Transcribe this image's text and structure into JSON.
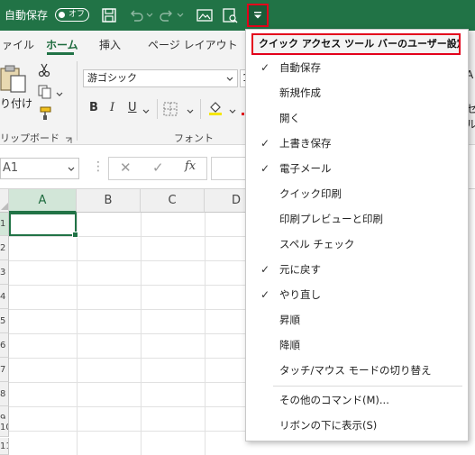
{
  "titlebar": {
    "autosave_label": "自動保存",
    "autosave_state": "オフ",
    "qa_icons": [
      "save-icon",
      "undo-icon",
      "redo-icon",
      "new-file-icon",
      "print-preview-icon",
      "customize-dropdown-icon"
    ]
  },
  "ribbon": {
    "tabs": [
      "ァイル",
      "ホーム",
      "挿入",
      "ページ レイアウト"
    ],
    "active_tab": "ホーム",
    "clipboard": {
      "paste_label": "り付け",
      "group_label": "リップボード"
    },
    "font": {
      "name": "游ゴシック",
      "size": "1",
      "group_label": "フォント",
      "bold": "B",
      "italic": "I",
      "underline": "U"
    },
    "right_fragment_1": "A",
    "right_fragment_2": "セル"
  },
  "formula_bar": {
    "name_box": "A1",
    "fx": "fx"
  },
  "grid": {
    "columns": [
      "A",
      "B",
      "C",
      "D"
    ],
    "row_numbers": [
      "1",
      "2",
      "3",
      "4",
      "5",
      "6",
      "7",
      "8",
      "9",
      "10",
      "11"
    ],
    "selected_column": "A"
  },
  "menu": {
    "header": "クイック アクセス ツール バーのユーザー設定",
    "items": [
      {
        "label": "自動保存",
        "checked": true
      },
      {
        "label": "新規作成",
        "checked": false
      },
      {
        "label": "開く",
        "checked": false
      },
      {
        "label": "上書き保存",
        "checked": true
      },
      {
        "label": "電子メール",
        "checked": true
      },
      {
        "label": "クイック印刷",
        "checked": false
      },
      {
        "label": "印刷プレビューと印刷",
        "checked": false
      },
      {
        "label": "スペル チェック",
        "checked": false
      },
      {
        "label": "元に戻す",
        "checked": true
      },
      {
        "label": "やり直し",
        "checked": true
      },
      {
        "label": "昇順",
        "checked": false
      },
      {
        "label": "降順",
        "checked": false
      },
      {
        "label": "タッチ/マウス モードの切り替え",
        "checked": false
      },
      {
        "label": "その他のコマンド(M)...",
        "checked": false
      },
      {
        "label": "リボンの下に表示(S)",
        "checked": false
      }
    ],
    "check_glyph": "✓"
  },
  "colors": {
    "excel_green": "#217346",
    "highlight_red": "#e3001b"
  }
}
